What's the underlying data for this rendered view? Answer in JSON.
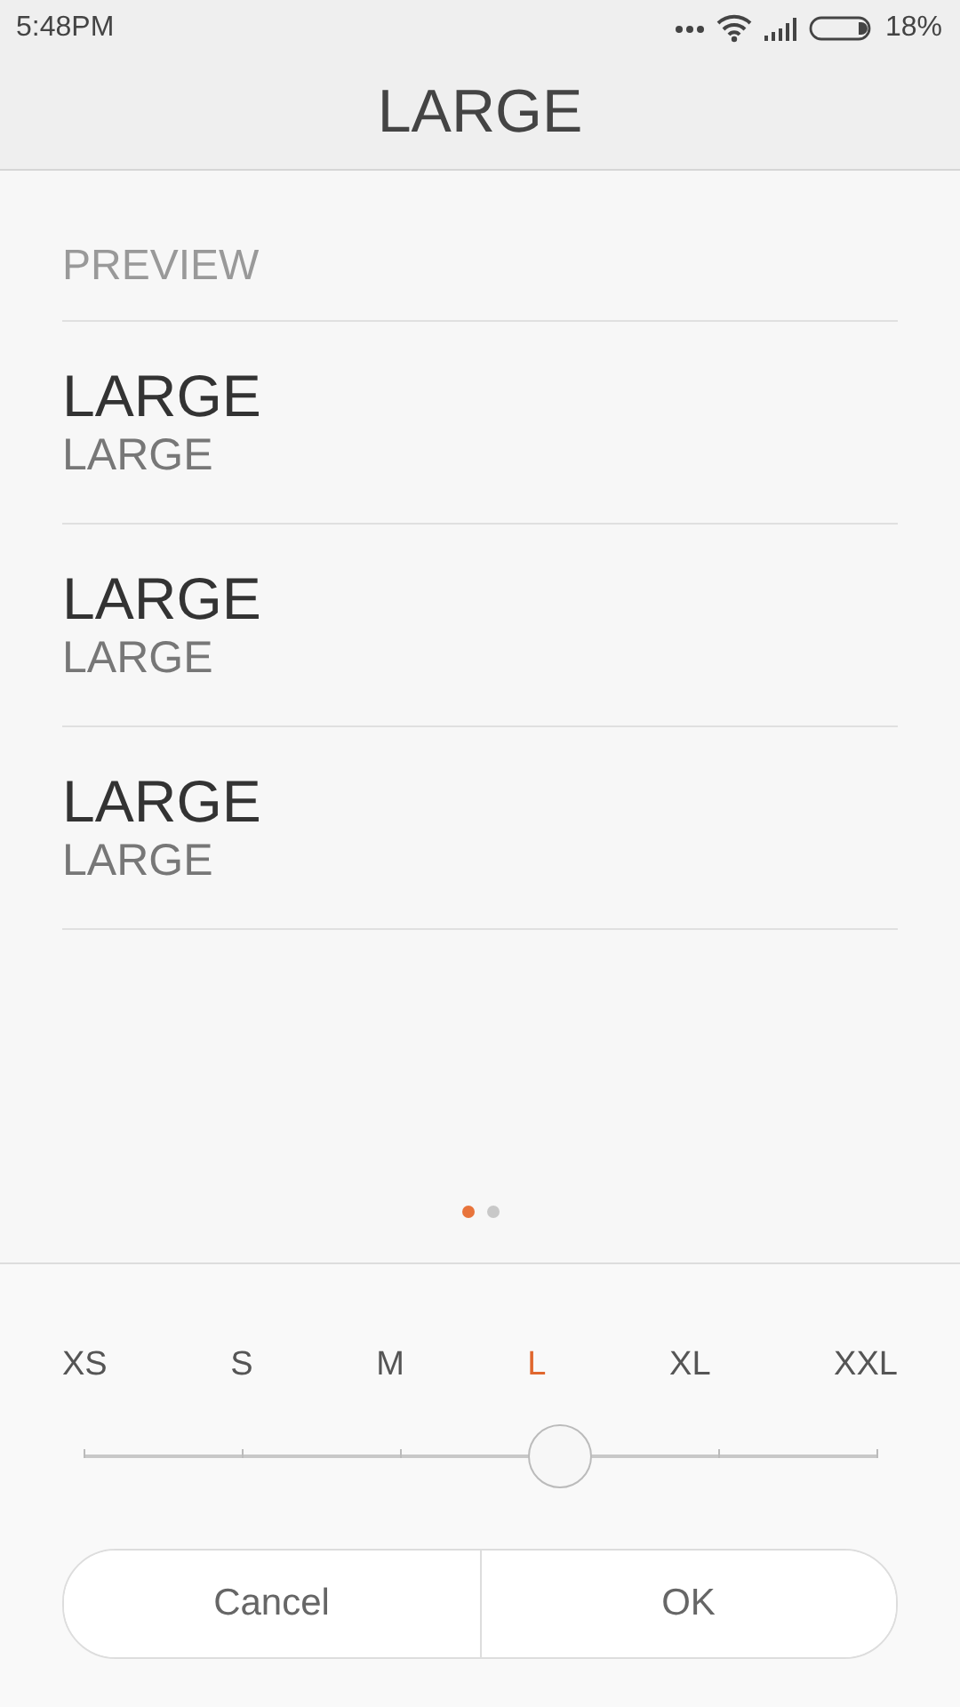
{
  "status_bar": {
    "time": "5:48PM",
    "battery": "18%"
  },
  "header": {
    "title": "LARGE"
  },
  "preview": {
    "label": "PREVIEW",
    "items": [
      {
        "title": "LARGE",
        "subtitle": "LARGE"
      },
      {
        "title": "LARGE",
        "subtitle": "LARGE"
      },
      {
        "title": "LARGE",
        "subtitle": "LARGE"
      }
    ]
  },
  "pager": [
    {
      "selected": true
    },
    {
      "selected": false
    }
  ],
  "sizes": [
    {
      "label": "XS",
      "selected": false
    },
    {
      "label": "S",
      "selected": false
    },
    {
      "label": "M",
      "selected": false
    },
    {
      "label": "L",
      "selected": true
    },
    {
      "label": "XL",
      "selected": false
    },
    {
      "label": "XXL",
      "selected": false
    }
  ],
  "slider": {
    "level": 0.6
  },
  "buttons": [
    "Cancel",
    "OK"
  ]
}
